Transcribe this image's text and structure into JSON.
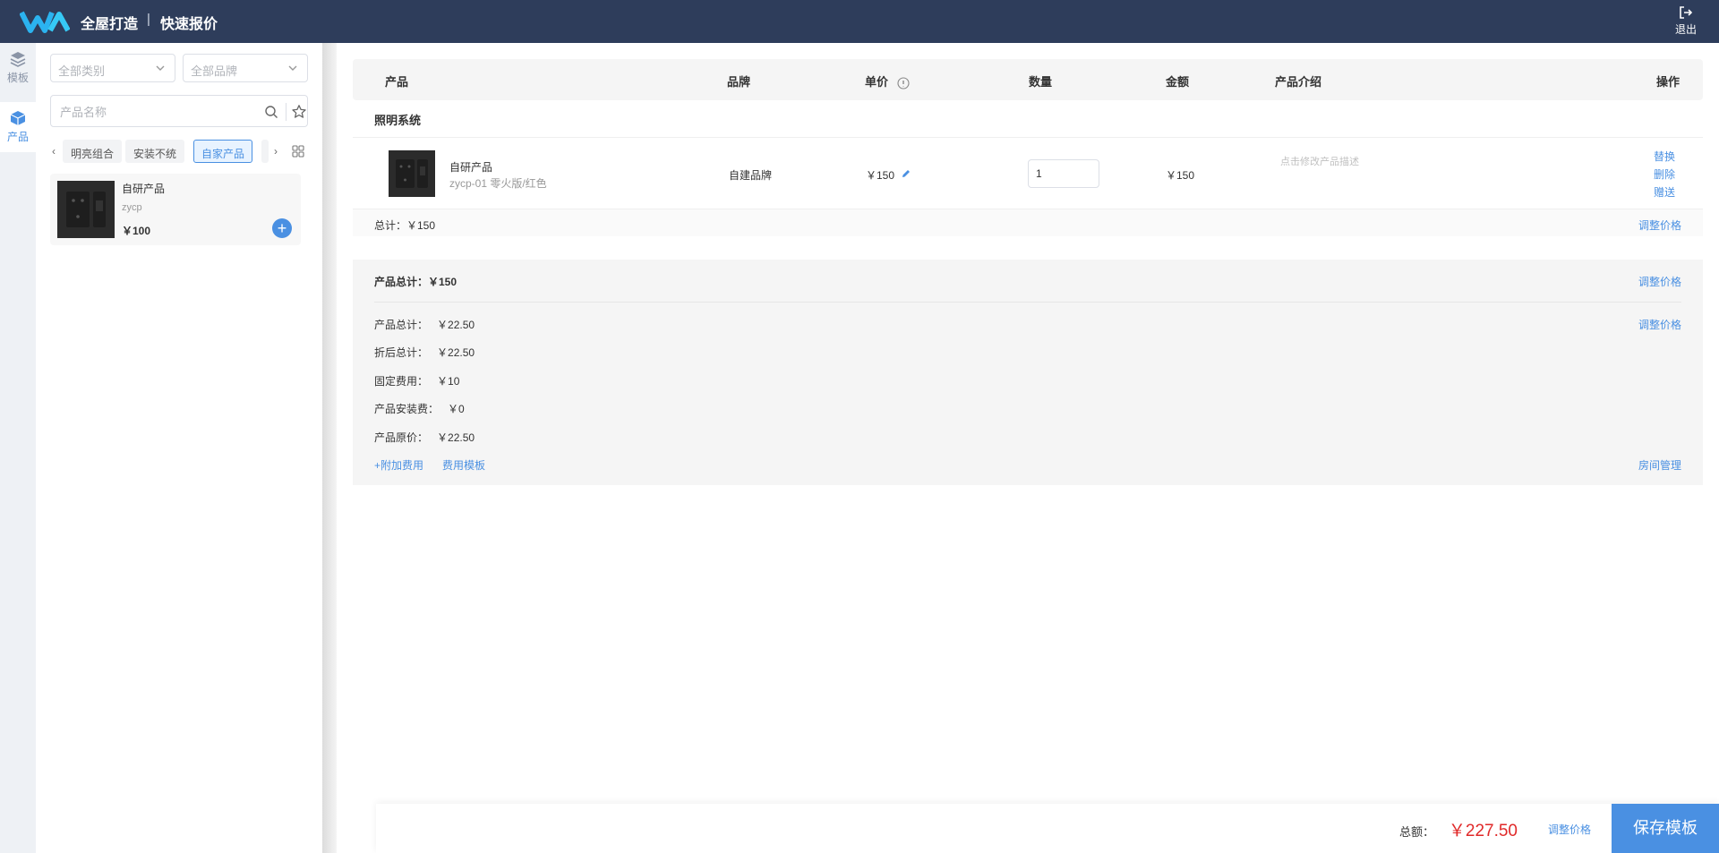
{
  "header": {
    "brand": "全屋打造",
    "separator": "|",
    "subtitle": "快速报价",
    "logout_label": "退出"
  },
  "rail": {
    "items": [
      {
        "label": "模板",
        "icon": "layers-icon",
        "active": false
      },
      {
        "label": "产品",
        "icon": "box-icon",
        "active": true
      }
    ]
  },
  "filters": {
    "category_placeholder": "全部类别",
    "brand_placeholder": "全部品牌",
    "search_placeholder": "产品名称"
  },
  "tags": [
    "明亮组合",
    "安装不统",
    "自家产品"
  ],
  "active_tag": "自家产品",
  "product_card": {
    "name": "自研产品",
    "code": "zycp",
    "price": "￥100"
  },
  "table": {
    "headers": {
      "product": "产品",
      "brand": "品牌",
      "unit_price": "单价",
      "quantity": "数量",
      "amount": "金额",
      "description": "产品介绍",
      "actions": "操作"
    },
    "group": {
      "title": "照明系统",
      "rows": [
        {
          "name": "自研产品",
          "spec": "zycp-01 零火版/红色",
          "brand": "自建品牌",
          "unit_price": "￥150",
          "quantity": "1",
          "amount": "￥150",
          "description": "点击修改产品描述",
          "actions": [
            "替换",
            "删除",
            "赠送"
          ]
        }
      ],
      "subtotal": "总计：￥150",
      "adjust_label": "调整价格"
    }
  },
  "summary": {
    "title": "产品总计：￥150",
    "adjust_label": "调整价格",
    "rows": [
      {
        "label": "产品总计：",
        "value": "￥22.50"
      },
      {
        "label": "折后总计：",
        "value": "￥22.50"
      },
      {
        "label": "固定费用：",
        "value": "￥10"
      },
      {
        "label": "产品安装费：",
        "value": "￥0"
      },
      {
        "label": "产品原价：",
        "value": "￥22.50"
      }
    ],
    "adjust_label_2": "调整价格",
    "extra_fee": "+附加费用",
    "fee_template": "费用模板",
    "room_manage": "房间管理"
  },
  "footer": {
    "total_label": "总额：",
    "total_value": "￥227.50",
    "adjust_label": "调整价格",
    "save_label": "保存模板"
  },
  "colors": {
    "header_bg": "#2e3d5b",
    "accent": "#4a90e2",
    "price_red": "#e02929"
  }
}
